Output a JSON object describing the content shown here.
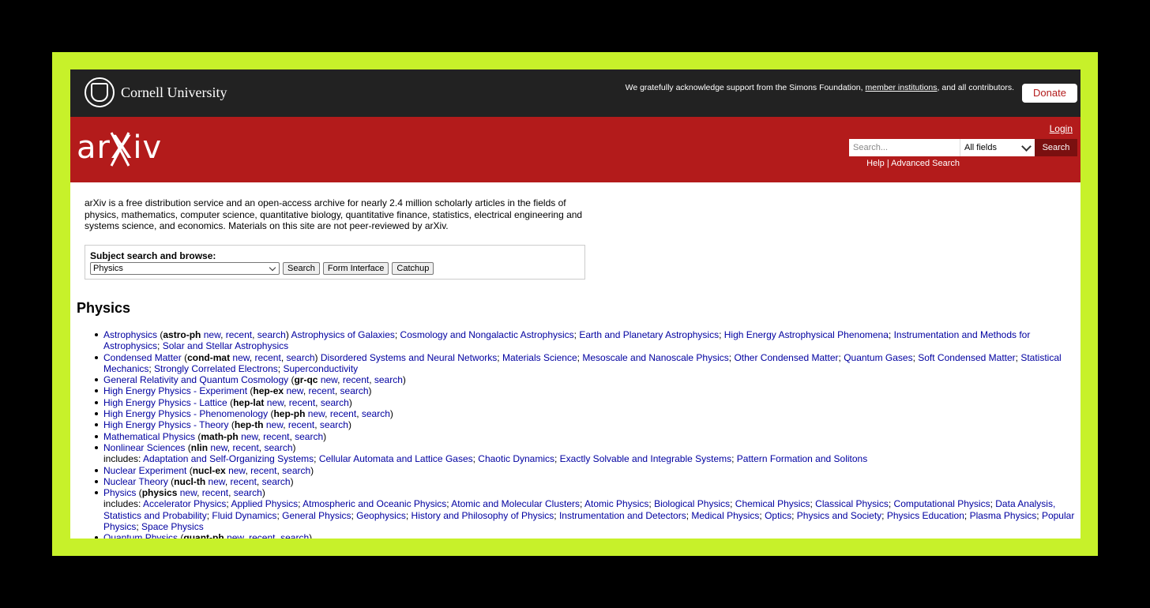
{
  "top": {
    "university": "Cornell University",
    "ack_text": "We gratefully acknowledge support from the Simons Foundation, ",
    "ack_link": "member institutions",
    "ack_tail": ", and all contributors.",
    "donate": "Donate"
  },
  "header": {
    "logo": "arXiv",
    "login": "Login",
    "search_placeholder": "Search...",
    "field_select": "All fields",
    "search_button": "Search",
    "help": "Help",
    "sep": " | ",
    "advanced": "Advanced Search"
  },
  "intro": "arXiv is a free distribution service and an open-access archive for nearly 2.4 million scholarly articles in the fields of physics, mathematics, computer science, quantitative biology, quantitative finance, statistics, electrical engineering and systems science, and economics. Materials on this site are not peer-reviewed by arXiv.",
  "subject": {
    "label": "Subject search and browse:",
    "selected": "Physics",
    "search": "Search",
    "form": "Form Interface",
    "catchup": "Catchup"
  },
  "section_title": "Physics",
  "entries": [
    {
      "name": "Astrophysics",
      "code": "astro-ph",
      "subs": "Astrophysics of Galaxies; Cosmology and Nongalactic Astrophysics; Earth and Planetary Astrophysics; High Energy Astrophysical Phenomena; Instrumentation and Methods for Astrophysics; Solar and Stellar Astrophysics"
    },
    {
      "name": "Condensed Matter",
      "code": "cond-mat",
      "subs": "Disordered Systems and Neural Networks; Materials Science; Mesoscale and Nanoscale Physics; Other Condensed Matter; Quantum Gases; Soft Condensed Matter; Statistical Mechanics; Strongly Correlated Electrons; Superconductivity"
    },
    {
      "name": "General Relativity and Quantum Cosmology",
      "code": "gr-qc",
      "subs": ""
    },
    {
      "name": "High Energy Physics - Experiment",
      "code": "hep-ex",
      "subs": ""
    },
    {
      "name": "High Energy Physics - Lattice",
      "code": "hep-lat",
      "subs": ""
    },
    {
      "name": "High Energy Physics - Phenomenology",
      "code": "hep-ph",
      "subs": ""
    },
    {
      "name": "High Energy Physics - Theory",
      "code": "hep-th",
      "subs": ""
    },
    {
      "name": "Mathematical Physics",
      "code": "math-ph",
      "subs": ""
    },
    {
      "name": "Nonlinear Sciences",
      "code": "nlin",
      "includes": "Adaptation and Self-Organizing Systems; Cellular Automata and Lattice Gases; Chaotic Dynamics; Exactly Solvable and Integrable Systems; Pattern Formation and Solitons"
    },
    {
      "name": "Nuclear Experiment",
      "code": "nucl-ex",
      "subs": ""
    },
    {
      "name": "Nuclear Theory",
      "code": "nucl-th",
      "subs": ""
    },
    {
      "name": "Physics",
      "code": "physics",
      "includes": "Accelerator Physics; Applied Physics; Atmospheric and Oceanic Physics; Atomic and Molecular Clusters; Atomic Physics; Biological Physics; Chemical Physics; Classical Physics; Computational Physics; Data Analysis, Statistics and Probability; Fluid Dynamics; General Physics; Geophysics; History and Philosophy of Physics; Instrumentation and Detectors; Medical Physics; Optics; Physics and Society; Physics Education; Plasma Physics; Popular Physics; Space Physics"
    },
    {
      "name": "Quantum Physics",
      "code": "quant-ph",
      "subs": ""
    }
  ],
  "link_words": {
    "new": "new",
    "recent": "recent",
    "search": "search",
    "includes": "includes: "
  }
}
